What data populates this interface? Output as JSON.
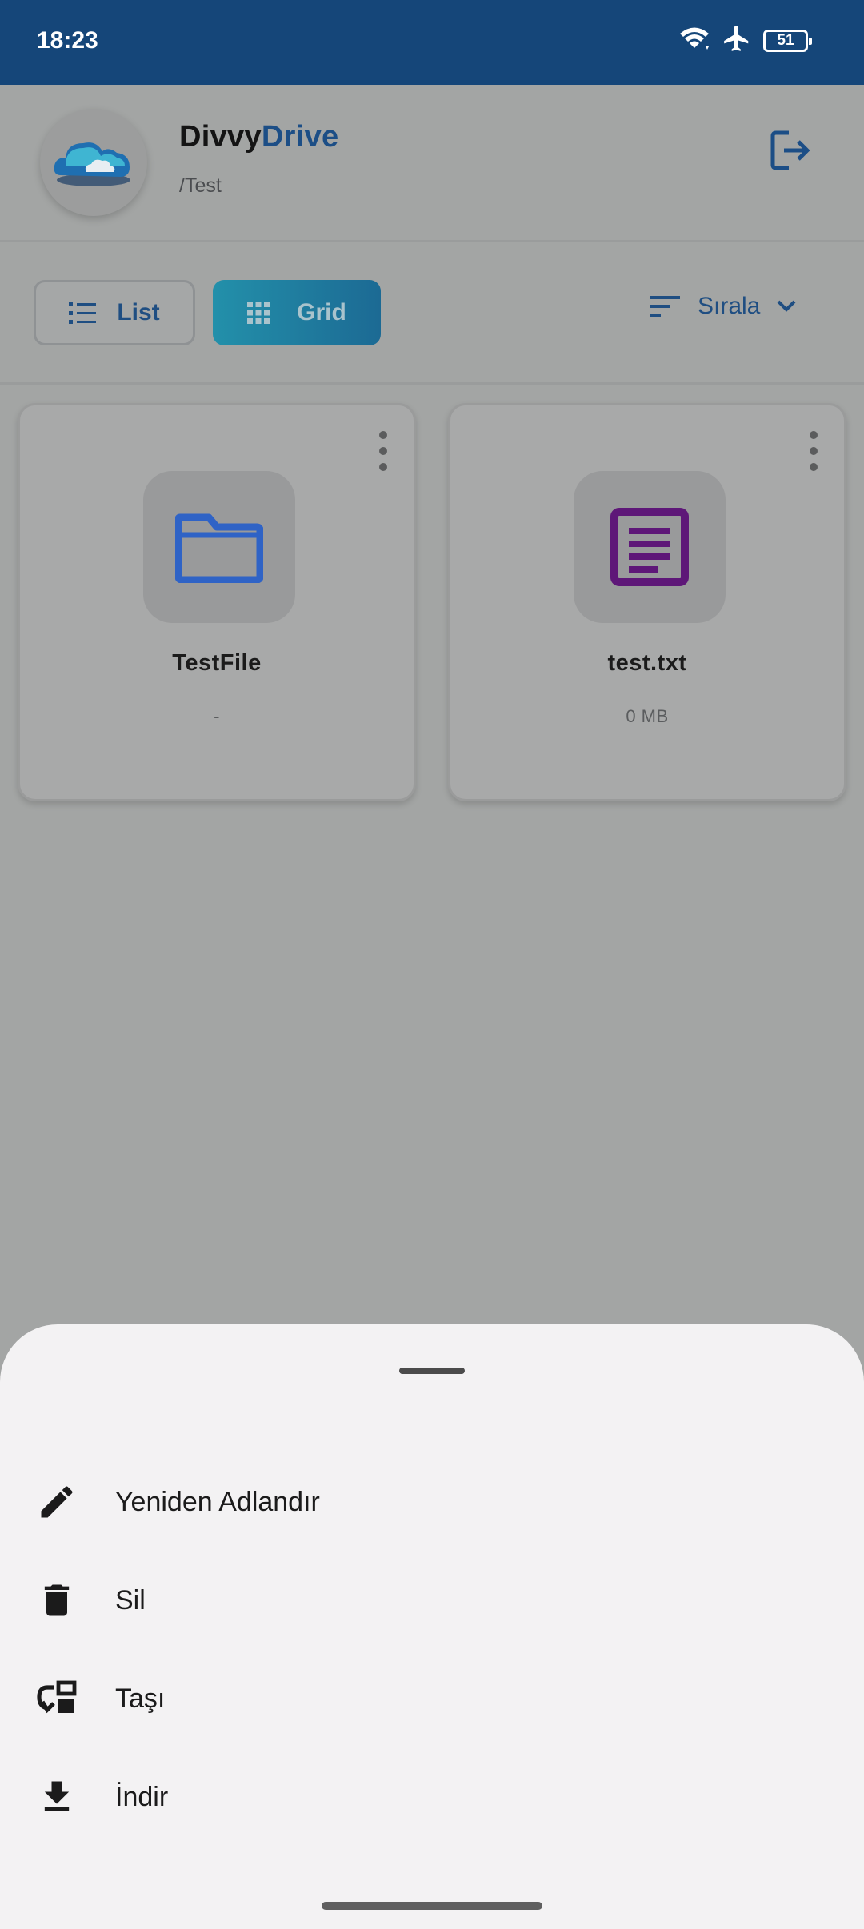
{
  "status_bar": {
    "time": "18:23",
    "battery": "51"
  },
  "header": {
    "brand_part1": "Divvy",
    "brand_part2": "Drive",
    "path": "/Test"
  },
  "toolbar": {
    "list_label": "List",
    "grid_label": "Grid",
    "sort_label": "Sırala"
  },
  "files": [
    {
      "name": "TestFile",
      "size": "-",
      "type": "folder"
    },
    {
      "name": "test.txt",
      "size": "0 MB",
      "type": "text-file"
    }
  ],
  "sheet_actions": [
    {
      "label": "Yeniden Adlandır",
      "icon": "edit-icon"
    },
    {
      "label": "Sil",
      "icon": "delete-icon"
    },
    {
      "label": "Taşı",
      "icon": "move-icon"
    },
    {
      "label": "İndir",
      "icon": "download-icon"
    }
  ],
  "colors": {
    "status_bar": "#154679",
    "brand_accent": "#1c4e86",
    "folder_icon": "#2f63c6",
    "text_file_icon": "#5e1778",
    "sheet_bg": "#f3f2f3"
  }
}
